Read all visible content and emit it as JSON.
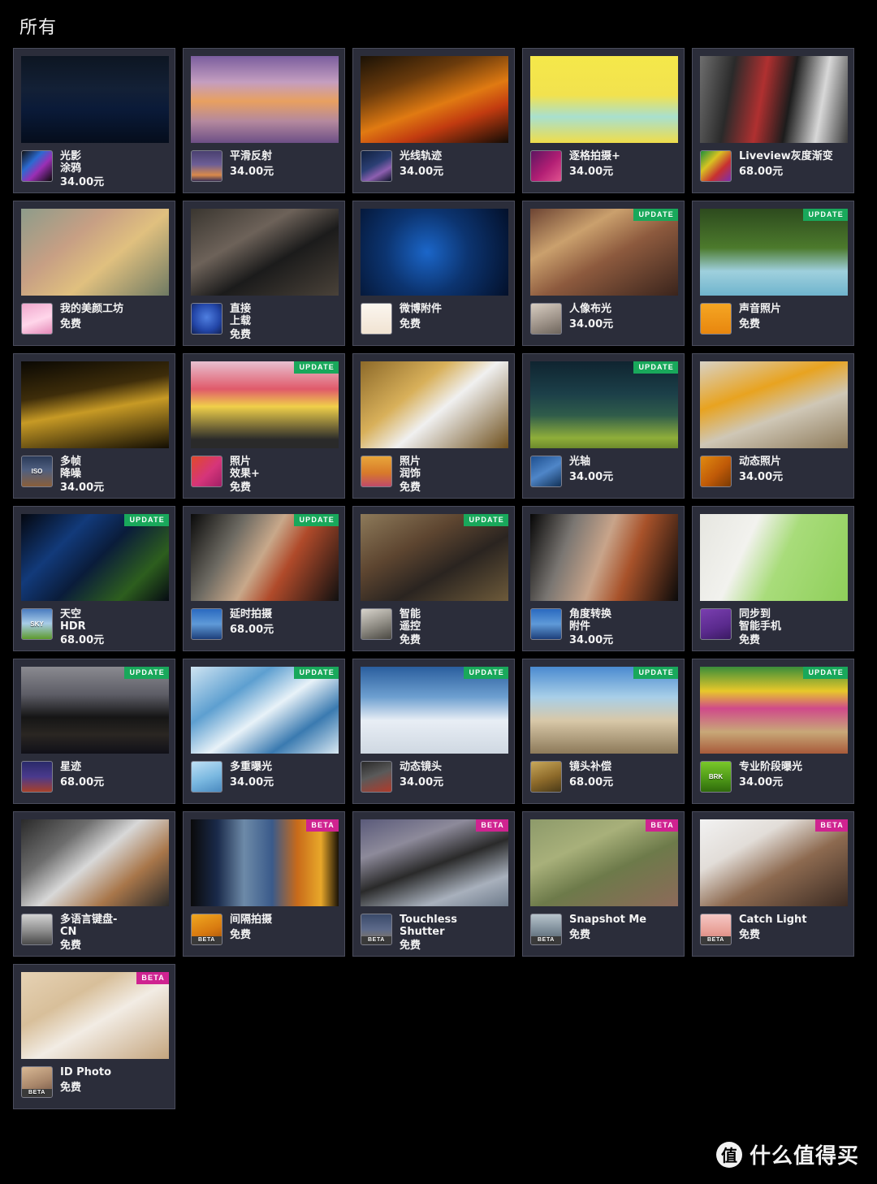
{
  "page": {
    "title": "所有",
    "badge_update_label": "UPDATE",
    "badge_beta_label": "BETA",
    "icon_beta_label": "BETA",
    "colors": {
      "background": "#000000",
      "card_background": "#2b2d3a",
      "card_border": "#4a4c5c",
      "text": "#f3f3f3",
      "badge_update": "#19a85b",
      "badge_beta": "#cf2390"
    }
  },
  "watermark": {
    "logo_char": "值",
    "text": "什么值得买"
  },
  "apps": [
    {
      "name": "光影\n涂鸦",
      "price": "34.00元",
      "badge": "",
      "icon_name": "light-painting-icon",
      "icon_text": "",
      "icon_beta": false,
      "thumb": {
        "name": "night-bridge-light-painting-thumb",
        "css": "linear-gradient(180deg,#0d1622 0%,#132036 38%,#0a1a38 62%,#050d1c 100%)"
      },
      "icon_css": "linear-gradient(135deg,#111 0%,#2b6ad1 35%,#9b2fb5 60%,#0a0a0a 100%)"
    },
    {
      "name": "平滑反射",
      "price": "34.00元",
      "badge": "",
      "icon_name": "smooth-reflection-icon",
      "icon_text": "",
      "icon_beta": false,
      "thumb": {
        "name": "sunset-harbour-reflection-thumb",
        "css": "linear-gradient(180deg,#7b5e9e 0%,#c49ec0 30%,#e8a060 52%,#b4899e 75%,#6d4f86 100%)"
      },
      "icon_css": "linear-gradient(180deg,#4a4070 0%,#6c5e96 45%,#d98a4a 80%,#3a2f55 100%)"
    },
    {
      "name": "光线轨迹",
      "price": "34.00元",
      "badge": "",
      "icon_name": "light-trail-icon",
      "icon_text": "",
      "icon_beta": false,
      "thumb": {
        "name": "highway-light-trails-thumb",
        "css": "linear-gradient(160deg,#1b1206 0%,#6b3b0c 30%,#e07a12 55%,#c23b10 72%,#120c05 100%)"
      },
      "icon_css": "linear-gradient(150deg,#10203f 0%,#2b3f74 45%,#8d5fb0 70%,#0a1228 100%)"
    },
    {
      "name": "逐格拍摄+",
      "price": "34.00元",
      "badge": "",
      "icon_name": "stop-motion-icon",
      "icon_text": "",
      "icon_beta": false,
      "thumb": {
        "name": "girl-butterfly-yellow-thumb",
        "css": "linear-gradient(180deg,#f5e84a 0%,#f2e24e 45%,#a8e0cf 70%,#f0dd4a 100%)"
      },
      "icon_css": "linear-gradient(135deg,#5d1560 0%,#b21e74 55%,#e0528f 100%)"
    },
    {
      "name": "Liveview灰度渐变",
      "price": "68.00元",
      "badge": "",
      "icon_name": "liveview-gradient-icon",
      "icon_text": "",
      "icon_beta": false,
      "thumb": {
        "name": "film-strip-thumb",
        "css": "linear-gradient(100deg,#6e6e6e 0%,#2a2a2a 22%,#b03030 42%,#1c1c1c 60%,#d8d8d8 80%,#3a3a3a 100%)"
      },
      "icon_css": "linear-gradient(135deg,#1f8f3b 0%,#d8c322 35%,#c83030 65%,#7b2fb0 100%)"
    },
    {
      "name": "我的美颜工坊",
      "price": "免费",
      "badge": "",
      "icon_name": "beauty-studio-icon",
      "icon_text": "",
      "icon_beta": false,
      "thumb": {
        "name": "portrait-girl-window-thumb",
        "css": "linear-gradient(140deg,#8d9c8a 0%,#c79f84 35%,#e0c07f 60%,#6f7a63 100%)"
      },
      "icon_css": "linear-gradient(160deg,#f0a7cd 0%,#ffd6ea 55%,#e58ab8 100%)"
    },
    {
      "name": "直接\n上载",
      "price": "免费",
      "badge": "",
      "icon_name": "direct-upload-icon",
      "icon_text": "",
      "icon_beta": false,
      "thumb": {
        "name": "tablet-in-hands-thumb",
        "css": "linear-gradient(150deg,#3a3630 0%,#6d6259 35%,#1b1b1b 60%,#4a4239 100%)"
      },
      "icon_css": "radial-gradient(circle at 50% 45%,#4f7fe0 0%,#2346a8 60%,#122255 100%)"
    },
    {
      "name": "微博附件",
      "price": "免费",
      "badge": "",
      "icon_name": "weibo-plugin-icon",
      "icon_text": "",
      "icon_beta": false,
      "thumb": {
        "name": "weibo-share-photos-thumb",
        "css": "radial-gradient(circle at 45% 50%,#1b66c9 0%,#0c3470 45%,#03102a 100%)"
      },
      "icon_css": "linear-gradient(180deg,#fbf6ef 0%,#f1e3d2 100%)"
    },
    {
      "name": "人像布光",
      "price": "34.00元",
      "badge": "UPDATE",
      "icon_name": "portrait-lighting-icon",
      "icon_text": "",
      "icon_beta": false,
      "thumb": {
        "name": "portrait-girl-sofa-thumb",
        "css": "linear-gradient(150deg,#6d4433 0%,#caa06d 30%,#8d5a3e 55%,#3a241c 100%)"
      },
      "icon_css": "linear-gradient(160deg,#d8cec2 0%,#9b9086 60%,#6e655c 100%)"
    },
    {
      "name": "声音照片",
      "price": "免费",
      "badge": "UPDATE",
      "icon_name": "sound-photo-icon",
      "icon_text": "",
      "icon_beta": false,
      "thumb": {
        "name": "kids-jumping-pool-thumb",
        "css": "linear-gradient(180deg,#2d4a1e 0%,#4c7a2c 45%,#9fd0dd 72%,#6fb4cd 100%)"
      },
      "icon_css": "linear-gradient(180deg,#f5a623 0%,#e8860e 100%)"
    },
    {
      "name": "多帧\n降噪",
      "price": "34.00元",
      "badge": "",
      "icon_name": "multi-frame-nr-icon",
      "icon_text": "ISO",
      "icon_beta": false,
      "thumb": {
        "name": "night-palace-architecture-thumb",
        "css": "linear-gradient(170deg,#0a0803 0%,#3e2d0a 35%,#c79a25 55%,#120d03 100%)"
      },
      "icon_css": "linear-gradient(180deg,#2a3a58 0%,#4f5f80 45%,#8a5f3a 100%)"
    },
    {
      "name": "照片\n效果+",
      "price": "免费",
      "badge": "UPDATE",
      "icon_name": "photo-effect-icon",
      "icon_text": "",
      "icon_beta": false,
      "thumb": {
        "name": "flower-market-thumb",
        "css": "linear-gradient(180deg,#e8c0d0 0%,#e05a6a 32%,#f0d04a 52%,#2a2a2a 90%)"
      },
      "icon_css": "linear-gradient(135deg,#e04a2a 0%,#d6357a 55%,#a11f66 100%)"
    },
    {
      "name": "照片\n润饰",
      "price": "免费",
      "badge": "",
      "icon_name": "photo-retouch-icon",
      "icon_text": "",
      "icon_beta": false,
      "thumb": {
        "name": "photo-frames-couple-thumb",
        "css": "linear-gradient(140deg,#8d6a2a 0%,#d8b05a 35%,#f0f0f0 55%,#6e4f1c 100%)"
      },
      "icon_css": "linear-gradient(180deg,#e8a63a 0%,#d87a2a 55%,#c04a6a 100%)"
    },
    {
      "name": "光轴",
      "price": "34.00元",
      "badge": "UPDATE",
      "icon_name": "light-shaft-icon",
      "icon_text": "",
      "icon_beta": false,
      "thumb": {
        "name": "green-field-light-thumb",
        "css": "linear-gradient(180deg,#0f2430 0%,#1c4049 38%,#2f5c4a 62%,#8fae3a 88%,#6d8a2c 100%)"
      },
      "icon_css": "linear-gradient(150deg,#1e4f8f 0%,#4f86c8 50%,#123258 100%)"
    },
    {
      "name": "动态照片",
      "price": "34.00元",
      "badge": "",
      "icon_name": "motion-photo-icon",
      "icon_text": "",
      "icon_beta": false,
      "thumb": {
        "name": "orange-juice-pour-thumb",
        "css": "linear-gradient(160deg,#d8d2c6 0%,#e8a320 35%,#cfc7b6 60%,#8d7a5a 100%)"
      },
      "icon_css": "linear-gradient(135deg,#e08a10 0%,#c05a08 55%,#7a3a04 100%)"
    },
    {
      "name": "天空\nHDR",
      "price": "68.00元",
      "badge": "UPDATE",
      "icon_name": "sky-hdr-icon",
      "icon_text": "SKY",
      "icon_beta": false,
      "thumb": {
        "name": "sky-hdr-preview-thumb",
        "css": "linear-gradient(135deg,#04070f 0%,#123a7a 30%,#0a1c3a 52%,#2d5e1e 78%,#050a12 100%)"
      },
      "icon_css": "linear-gradient(180deg,#4a7cc0 0%,#a8cce8 48%,#5d9a2c 100%)"
    },
    {
      "name": "延时拍摄",
      "price": "68.00元",
      "badge": "UPDATE",
      "icon_name": "time-lapse-icon",
      "icon_text": "",
      "icon_beta": false,
      "thumb": {
        "name": "harbour-timelapse-stack-thumb",
        "css": "linear-gradient(120deg,#0a0a0a 0%,#6d6a62 28%,#c8a88a 48%,#b04a2a 64%,#101010 100%)"
      },
      "icon_css": "linear-gradient(180deg,#2a6ac0 0%,#5f9ad8 50%,#1d3f7a 100%)"
    },
    {
      "name": "智能\n遥控",
      "price": "免费",
      "badge": "UPDATE",
      "icon_name": "smart-remote-icon",
      "icon_text": "",
      "icon_beta": false,
      "thumb": {
        "name": "couple-sofa-camera-thumb",
        "css": "linear-gradient(150deg,#8d7a5a 0%,#5d4530 35%,#2a2420 62%,#6d5a3a 100%)"
      },
      "icon_css": "linear-gradient(160deg,#d8d4cc 0%,#8d8a82 55%,#4a4842 100%)"
    },
    {
      "name": "角度转换\n附件",
      "price": "34.00元",
      "badge": "",
      "icon_name": "angle-shift-addon-icon",
      "icon_text": "",
      "icon_beta": false,
      "thumb": {
        "name": "angle-shift-stack-thumb",
        "css": "linear-gradient(110deg,#060606 0%,#7a7672 26%,#c8a48a 48%,#a8522a 66%,#0a0a0a 100%)"
      },
      "icon_css": "linear-gradient(180deg,#2a6ac0 0%,#5f9ad8 50%,#1d3f7a 100%)"
    },
    {
      "name": "同步到\n智能手机",
      "price": "免费",
      "badge": "",
      "icon_name": "sync-to-smartphone-icon",
      "icon_text": "",
      "icon_beta": false,
      "thumb": {
        "name": "camera-to-phone-sync-thumb",
        "css": "linear-gradient(115deg,#e6e6e0 0%,#f2f2ee 32%,#a8dc7a 55%,#8fcf5a 100%)"
      },
      "icon_css": "linear-gradient(160deg,#7a3fb0 0%,#5a2a8d 60%,#3a1a62 100%)"
    },
    {
      "name": "星迹",
      "price": "68.00元",
      "badge": "UPDATE",
      "icon_name": "star-trail-icon",
      "icon_text": "",
      "icon_beta": false,
      "thumb": {
        "name": "star-trails-night-thumb",
        "css": "linear-gradient(180deg,#8a8a90 0%,#5d5d66 32%,#151515 58%,#2a2622 78%,#101018 100%)"
      },
      "icon_css": "linear-gradient(180deg,#2a2a6a 0%,#4a3a8d 50%,#a8402a 100%)"
    },
    {
      "name": "多重曝光",
      "price": "34.00元",
      "badge": "UPDATE",
      "icon_name": "multiple-exposure-icon",
      "icon_text": "",
      "icon_beta": false,
      "thumb": {
        "name": "airplane-double-exposure-thumb",
        "css": "linear-gradient(145deg,#cfe4f2 0%,#5d9fd0 30%,#e8f2f8 52%,#3a7ab0 75%,#d8e8f2 100%)"
      },
      "icon_css": "linear-gradient(160deg,#bfe0f5 0%,#7ab8e0 55%,#4a8ac0 100%)"
    },
    {
      "name": "动态镜头",
      "price": "34.00元",
      "badge": "UPDATE",
      "icon_name": "motion-lens-icon",
      "icon_text": "",
      "icon_beta": false,
      "thumb": {
        "name": "snowboarders-sequence-thumb",
        "css": "linear-gradient(180deg,#2a5e9e 0%,#6ea0d0 35%,#e8eef5 62%,#cfd8e2 100%)"
      },
      "icon_css": "linear-gradient(160deg,#2a2a2a 0%,#5a5a5a 45%,#b03a2a 100%)"
    },
    {
      "name": "镜头补偿",
      "price": "68.00元",
      "badge": "UPDATE",
      "icon_name": "lens-compensation-icon",
      "icon_text": "",
      "icon_beta": false,
      "thumb": {
        "name": "street-lens-grid-thumb",
        "css": "linear-gradient(180deg,#4a8ad0 0%,#a8cfe8 35%,#d8c8a8 62%,#8d7a5a 100%)"
      },
      "icon_css": "linear-gradient(160deg,#c8a85a 0%,#8d6a2a 55%,#4a3a18 100%)"
    },
    {
      "name": "专业阶段曝光",
      "price": "34.00元",
      "badge": "UPDATE",
      "icon_name": "pro-bracketing-icon",
      "icon_text": "BRK",
      "icon_beta": false,
      "thumb": {
        "name": "pinwheels-bracket-thumb",
        "css": "linear-gradient(180deg,#3a8d3a 0%,#e8c82a 28%,#d04a8a 48%,#c8a878 75%,#a85a3a 100%)"
      },
      "icon_css": "linear-gradient(180deg,#7ac82a 0%,#4f9a18 55%,#2f6a0c 100%)"
    },
    {
      "name": "多语言键盘-\nCN",
      "price": "免费",
      "badge": "",
      "icon_name": "multilingual-keyboard-icon",
      "icon_text": "",
      "icon_beta": false,
      "thumb": {
        "name": "keyboard-input-girl-thumb",
        "css": "linear-gradient(140deg,#2a2a2a 0%,#6d6d6d 28%,#d8d8d8 48%,#a8764a 72%,#2a2a2a 100%)"
      },
      "icon_css": "linear-gradient(180deg,#d2d2d2 0%,#8d8d8d 55%,#4a4a4a 100%)"
    },
    {
      "name": "间隔拍摄",
      "price": "免费",
      "badge": "BETA",
      "icon_name": "interval-shooting-icon",
      "icon_text": "",
      "icon_beta": true,
      "thumb": {
        "name": "sunset-interval-strips-thumb",
        "css": "linear-gradient(90deg,#0a0a0a 0%,#1a2a4a 18%,#6d8aa8 36%,#3a5a8a 55%,#c86a1a 72%,#e8a82a 88%,#1a1206 100%)"
      },
      "icon_css": "linear-gradient(160deg,#f0a820 0%,#d87a10 55%,#9a4a08 100%)"
    },
    {
      "name": "Touchless\nShutter",
      "price": "免费",
      "badge": "BETA",
      "icon_name": "touchless-shutter-icon",
      "icon_text": "",
      "icon_beta": true,
      "thumb": {
        "name": "camera-hand-gesture-thumb",
        "css": "linear-gradient(160deg,#5a5a7a 0%,#8d8a9a 28%,#2a2a2a 52%,#a8b0bc 78%,#6d7a8a 100%)"
      },
      "icon_css": "linear-gradient(180deg,#3a4a6a 0%,#5d6a8a 50%,#8d7a5a 100%)"
    },
    {
      "name": "Snapshot Me",
      "price": "免费",
      "badge": "BETA",
      "icon_name": "snapshot-me-icon",
      "icon_text": "",
      "icon_beta": true,
      "thumb": {
        "name": "woman-sitting-rock-thumb",
        "css": "linear-gradient(155deg,#8d9a6a 0%,#a8b07a 32%,#6d7a4a 58%,#8d6a5a 100%)"
      },
      "icon_css": "linear-gradient(180deg,#b8c4cc 0%,#7a8a96 55%,#4a5560 100%)"
    },
    {
      "name": "Catch Light",
      "price": "免费",
      "badge": "BETA",
      "icon_name": "catch-light-icon",
      "icon_text": "",
      "icon_beta": true,
      "thumb": {
        "name": "portrait-short-hair-thumb",
        "css": "linear-gradient(150deg,#f2f2f2 0%,#e2ddd8 30%,#8d6a50 58%,#3a2a22 100%)"
      },
      "icon_css": "linear-gradient(180deg,#f5c8c4 0%,#e8a098 55%,#d07a70 100%)"
    },
    {
      "name": "ID Photo",
      "price": "免费",
      "badge": "BETA",
      "icon_name": "id-photo-icon",
      "icon_text": "",
      "icon_beta": true,
      "thumb": {
        "name": "passport-id-photo-thumb",
        "css": "linear-gradient(150deg,#e6d2b4 0%,#d8bf9a 32%,#f2ece4 55%,#c4a57e 100%)"
      },
      "icon_css": "linear-gradient(160deg,#d8b894 0%,#a8866a 55%,#6d5040 100%)"
    }
  ]
}
